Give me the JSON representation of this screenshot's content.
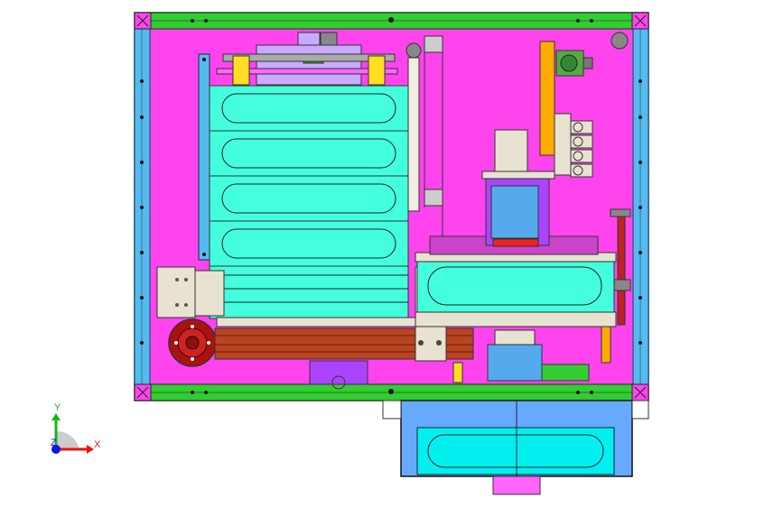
{
  "viewport": {
    "background": "#ffffff",
    "colors": {
      "frame": "#ff44ee",
      "rail": "#33cc33",
      "side_rail": "#55bbee",
      "tray": "#44ffdd",
      "outlet_box": "#66aaff",
      "outlet_slot": "#00f0f0",
      "motor": "#aa1111",
      "belt": "#b84422",
      "plate": "#e8e2d0",
      "purple_part": "#aa44ff",
      "blue_block": "#55aaee",
      "orange_arm": "#ffaa00"
    }
  },
  "triad": {
    "x_label": "X",
    "y_label": "Y",
    "z_label": "Z",
    "x_color": "#ee1111",
    "y_color": "#11bb11",
    "z_color": "#1111ee"
  }
}
